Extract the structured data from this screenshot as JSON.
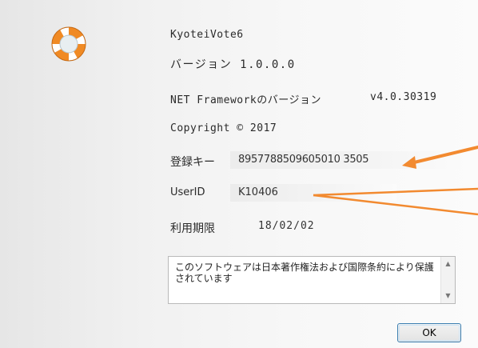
{
  "about": {
    "product_name": "KyoteiVote6",
    "version": "バージョン 1.0.0.0",
    "framework_label": "NET Frameworkのバージョン",
    "framework_version": "v4.0.30319",
    "copyright": "Copyright © 2017"
  },
  "fields": {
    "registration_key_label": "登録キー",
    "registration_key_value": "8957788509605010 3505",
    "user_id_label": "UserID",
    "user_id_value": "K10406",
    "expiry_label": "利用期限",
    "expiry_value": "18/02/02"
  },
  "notice": {
    "text": "このソフトウェアは日本著作権法および国際条約により保護されています",
    "scroll_up": "▲",
    "scroll_down": "▼"
  },
  "buttons": {
    "ok_label": "OK"
  },
  "icons": {
    "logo": "life-ring-icon"
  },
  "colors": {
    "logo_orange": "#f08a24",
    "annotation_orange": "#f28a30",
    "button_border": "#3c7fb1"
  }
}
